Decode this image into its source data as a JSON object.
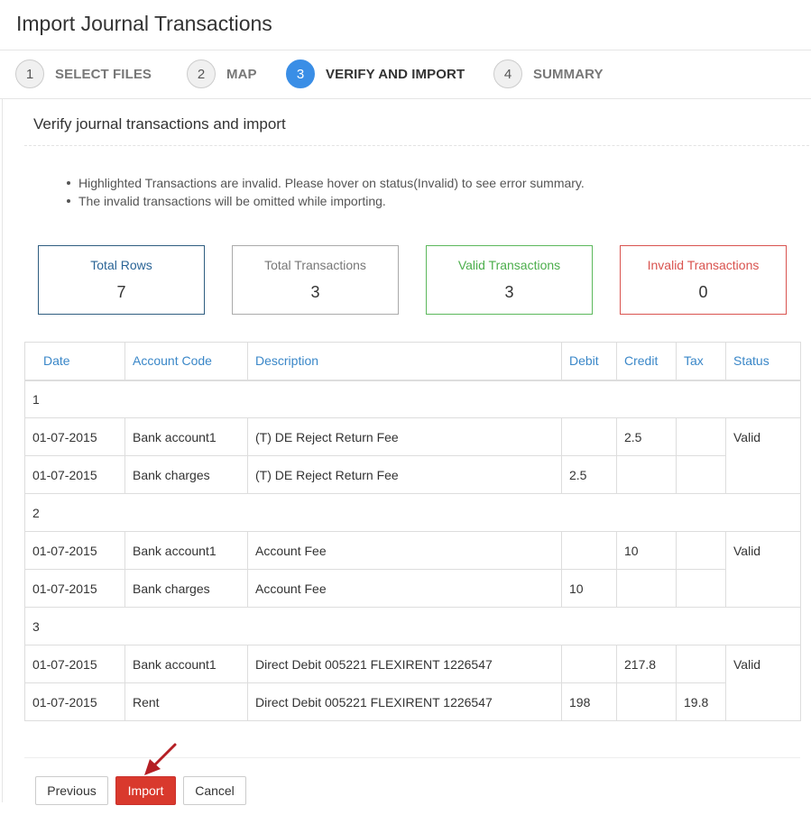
{
  "page": {
    "title": "Import Journal Transactions"
  },
  "wizard": {
    "steps": [
      {
        "num": "1",
        "label": "SELECT FILES"
      },
      {
        "num": "2",
        "label": "MAP"
      },
      {
        "num": "3",
        "label": "VERIFY AND IMPORT"
      },
      {
        "num": "4",
        "label": "SUMMARY"
      }
    ],
    "active_step": 3
  },
  "section": {
    "title": "Verify journal transactions and import",
    "notes": [
      "Highlighted Transactions are invalid. Please hover on status(Invalid) to see error summary.",
      "The invalid transactions will be omitted while importing."
    ]
  },
  "stats": {
    "total_rows": {
      "label": "Total Rows",
      "value": "7"
    },
    "total_transactions": {
      "label": "Total Transactions",
      "value": "3"
    },
    "valid_transactions": {
      "label": "Valid Transactions",
      "value": "3"
    },
    "invalid_transactions": {
      "label": "Invalid Transactions",
      "value": "0"
    }
  },
  "table": {
    "headers": [
      "Date",
      "Account Code",
      "Description",
      "Debit",
      "Credit",
      "Tax",
      "Status"
    ],
    "groups": [
      {
        "group": "1",
        "status": "Valid",
        "rows": [
          {
            "date": "01-07-2015",
            "account": "Bank account1",
            "description": "(T) DE Reject Return Fee",
            "debit": "",
            "credit": "2.5",
            "tax": ""
          },
          {
            "date": "01-07-2015",
            "account": "Bank charges",
            "description": "(T) DE Reject Return Fee",
            "debit": "2.5",
            "credit": "",
            "tax": ""
          }
        ]
      },
      {
        "group": "2",
        "status": "Valid",
        "rows": [
          {
            "date": "01-07-2015",
            "account": "Bank account1",
            "description": "Account Fee",
            "debit": "",
            "credit": "10",
            "tax": ""
          },
          {
            "date": "01-07-2015",
            "account": "Bank charges",
            "description": "Account Fee",
            "debit": "10",
            "credit": "",
            "tax": ""
          }
        ]
      },
      {
        "group": "3",
        "status": "Valid",
        "rows": [
          {
            "date": "01-07-2015",
            "account": "Bank account1",
            "description": "Direct Debit 005221 FLEXIRENT 1226547",
            "debit": "",
            "credit": "217.8",
            "tax": ""
          },
          {
            "date": "01-07-2015",
            "account": "Rent",
            "description": "Direct Debit 005221 FLEXIRENT 1226547",
            "debit": "198",
            "credit": "",
            "tax": "19.8"
          }
        ]
      }
    ]
  },
  "buttons": {
    "previous": "Previous",
    "import": "Import",
    "cancel": "Cancel"
  },
  "colors": {
    "accent": "#3a8ee6",
    "import_button": "#d9392d",
    "valid": "#5cb85c",
    "invalid": "#d9534f",
    "arrow": "#b51f24"
  }
}
